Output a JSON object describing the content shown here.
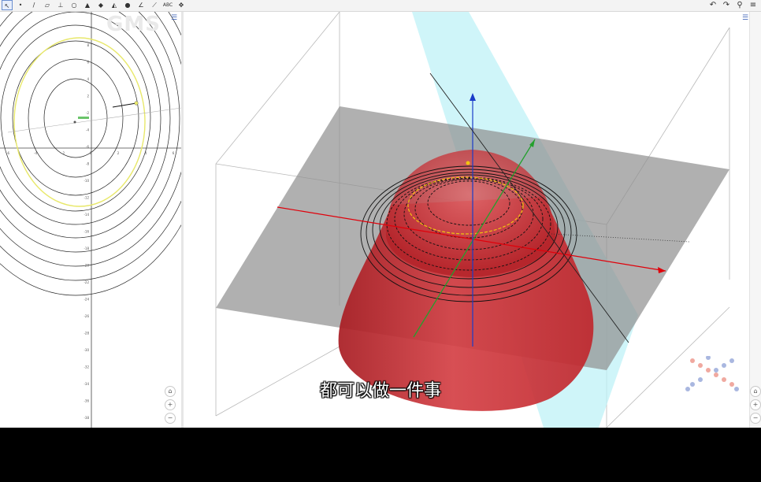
{
  "toolbar": {
    "tools": [
      {
        "name": "move-tool-icon",
        "glyph": "↖"
      },
      {
        "name": "point-tool-icon",
        "glyph": "•"
      },
      {
        "name": "line-tool-icon",
        "glyph": "/"
      },
      {
        "name": "plane-tool-icon",
        "glyph": "▱"
      },
      {
        "name": "perpendicular-tool-icon",
        "glyph": "⊥"
      },
      {
        "name": "circle-tool-icon",
        "glyph": "○"
      },
      {
        "name": "pyramid-tool-icon",
        "glyph": "▲"
      },
      {
        "name": "net-tool-icon",
        "glyph": "◆"
      },
      {
        "name": "cone-tool-icon",
        "glyph": "◭"
      },
      {
        "name": "sphere-tool-icon",
        "glyph": "●"
      },
      {
        "name": "angle-tool-icon",
        "glyph": "∠"
      },
      {
        "name": "reflect-tool-icon",
        "glyph": "⟋"
      },
      {
        "name": "text-tool-icon",
        "glyph": "ABC"
      },
      {
        "name": "move-view-tool-icon",
        "glyph": "✥"
      }
    ],
    "right": [
      {
        "name": "undo-icon",
        "glyph": "↶"
      },
      {
        "name": "redo-icon",
        "glyph": "↷"
      },
      {
        "name": "search-icon",
        "glyph": "⚲"
      },
      {
        "name": "menu-icon",
        "glyph": "≡"
      }
    ]
  },
  "watermark": "GMS",
  "graphics2d": {
    "x_ticks": [
      "-6",
      "-4",
      "-2",
      "0",
      "2",
      "4",
      "6"
    ],
    "y_ticks": [
      "8",
      "6",
      "4",
      "2",
      "-2",
      "-4",
      "-6",
      "-8",
      "-10",
      "-12",
      "-14",
      "-16",
      "-18",
      "-20",
      "-22",
      "-24",
      "-26",
      "-28",
      "-30",
      "-32",
      "-34",
      "-36",
      "-38",
      "-40"
    ],
    "accent_yellow": "#e8e86a",
    "contour_color": "#222222"
  },
  "graphics3d": {
    "surface_color": "#c0272d",
    "plane_color": "#8f8f8f",
    "cutting_plane_color": "#bff2f7",
    "x_axis_color": "#e0000a",
    "y_axis_color": "#23a02d",
    "z_axis_color": "#1a3cc8"
  },
  "view_controls": {
    "home": "⌂",
    "zoom_in": "+",
    "zoom_out": "−"
  },
  "subtitle": "都可以做一件事"
}
